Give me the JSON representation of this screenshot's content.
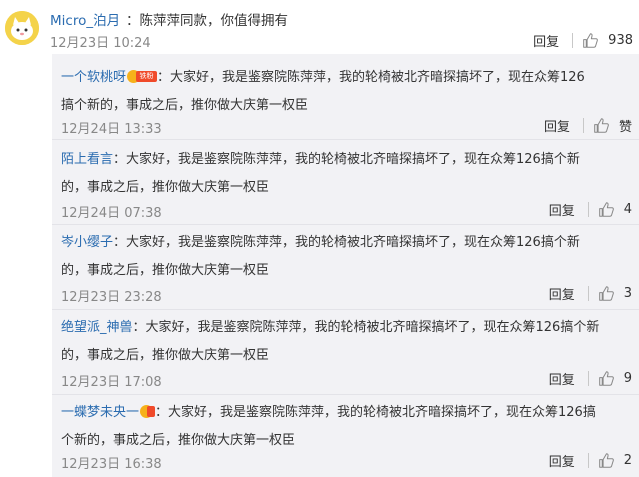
{
  "main_comment": {
    "username": "Micro_泊月",
    "text": "：陈萍萍同款，你值得拥有",
    "time": "12月23日 10:24",
    "reply_label": "回复",
    "likes": "938"
  },
  "replies": [
    {
      "username": "一个软桃呀",
      "text_line1": "：大家好，我是鉴察院陈萍萍，我的轮椅被北齐暗探搞坏了，现在众筹126",
      "text_line2": "搞个新的，事成之后，推你做大庆第一权臣",
      "time": "12月24日 13:33",
      "reply_label": "回复",
      "likes": "赞",
      "badge": "铁粉"
    },
    {
      "username": "陌上看言",
      "text_line1": "：大家好，我是鉴察院陈萍萍，我的轮椅被北齐暗探搞坏了，现在众筹126搞个新",
      "text_line2": "的，事成之后，推你做大庆第一权臣",
      "time": "12月24日 07:38",
      "reply_label": "回复",
      "likes": "4"
    },
    {
      "username": "岑小缨子",
      "text_line1": "：大家好，我是鉴察院陈萍萍，我的轮椅被北齐暗探搞坏了，现在众筹126搞个新",
      "text_line2": "的，事成之后，推你做大庆第一权臣",
      "time": "12月23日 23:28",
      "reply_label": "回复",
      "likes": "3"
    },
    {
      "username": "绝望派_神兽",
      "text_line1": "：大家好，我是鉴察院陈萍萍，我的轮椅被北齐暗探搞坏了，现在众筹126搞个新",
      "text_line2": "的，事成之后，推你做大庆第一权臣",
      "time": "12月23日 17:08",
      "reply_label": "回复",
      "likes": "9"
    },
    {
      "username": "一蝶梦未央一",
      "text_line1": "：大家好，我是鉴察院陈萍萍，我的轮椅被北齐暗探搞坏了，现在众筹126搞",
      "text_line2": "个新的，事成之后，推你做大庆第一权臣",
      "time": "12月23日 16:38",
      "reply_label": "回复",
      "likes": "2"
    }
  ],
  "icons": {
    "thumb": "thumbs-up-icon",
    "avatar": "cat-avatar-icon",
    "badge": "fan-badge-icon"
  },
  "colors": {
    "username": "#2b6cb0",
    "panel_bg": "#f2f2f5",
    "badge_red": "#f04a2a",
    "badge_gold": "#f6b11a"
  }
}
